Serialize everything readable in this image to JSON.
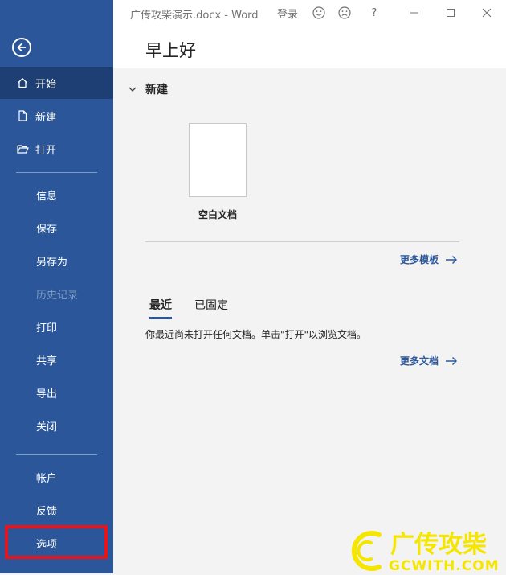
{
  "titlebar": {
    "doc_title": "广传攻柴演示.docx  -  Word",
    "signin": "登录",
    "smile_icon": "smile-icon",
    "frown_icon": "frown-icon",
    "help": "?"
  },
  "sidebar": {
    "back_icon": "back-arrow-icon",
    "items_top": [
      {
        "label": "开始",
        "icon": "home-icon"
      },
      {
        "label": "新建",
        "icon": "new-doc-icon"
      },
      {
        "label": "打开",
        "icon": "folder-open-icon"
      }
    ],
    "items_mid": [
      "信息",
      "保存",
      "另存为",
      "历史记录",
      "打印",
      "共享",
      "导出",
      "关闭"
    ],
    "items_bottom": [
      "帐户",
      "反馈",
      "选项"
    ]
  },
  "main": {
    "greeting": "早上好",
    "new_section": "新建",
    "blank_doc": "空白文档",
    "more_templates": "更多模板",
    "tabs": [
      "最近",
      "已固定"
    ],
    "empty_message": "你最近尚未打开任何文档。单击\"打开\"以浏览文档。",
    "more_docs": "更多文档"
  },
  "watermark": {
    "line1": "广传攻柴",
    "line2": "GCWITH.COM"
  },
  "colors": {
    "sidebar": "#2b579a",
    "sidebar_active": "#1e3f73",
    "highlight": "#e8141c",
    "watermark": "#f5e600"
  }
}
